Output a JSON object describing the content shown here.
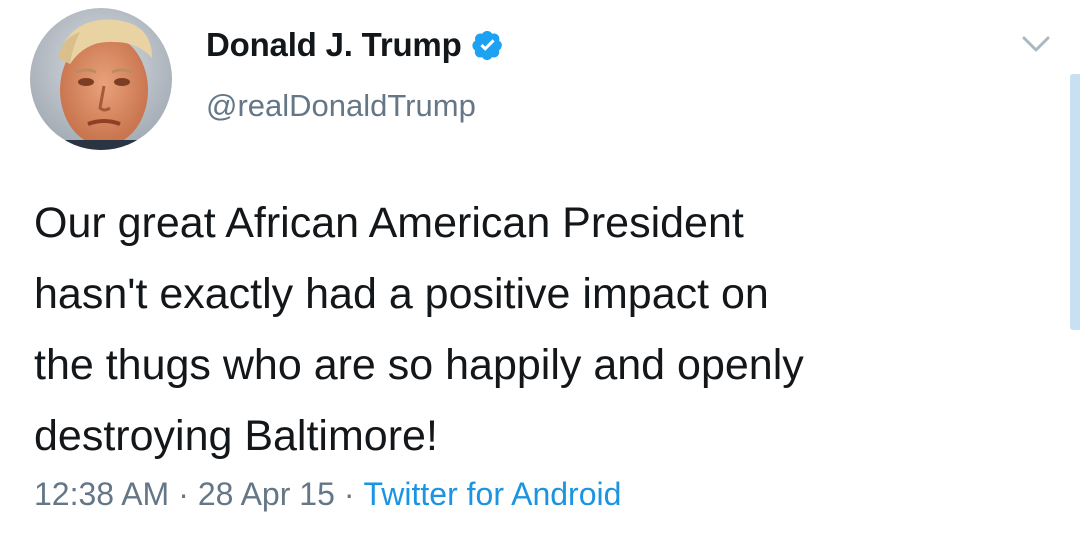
{
  "author": {
    "display_name": "Donald J. Trump",
    "handle": "@realDonaldTrump",
    "verified_icon": "verified-badge-icon",
    "avatar": "profile-photo"
  },
  "tweet": {
    "lines": [
      "Our great African American President",
      "hasn't exactly had a positive impact on",
      "the thugs who are so happily and openly",
      "destroying Baltimore!"
    ]
  },
  "meta": {
    "time": "12:38 AM",
    "separator": "·",
    "date": "28 Apr 15",
    "source": "Twitter for Android"
  },
  "icons": {
    "menu": "chevron-down-icon"
  },
  "colors": {
    "name": "#14171a",
    "secondary": "#657786",
    "link": "#1b95e0",
    "verified": "#1da1f2"
  }
}
